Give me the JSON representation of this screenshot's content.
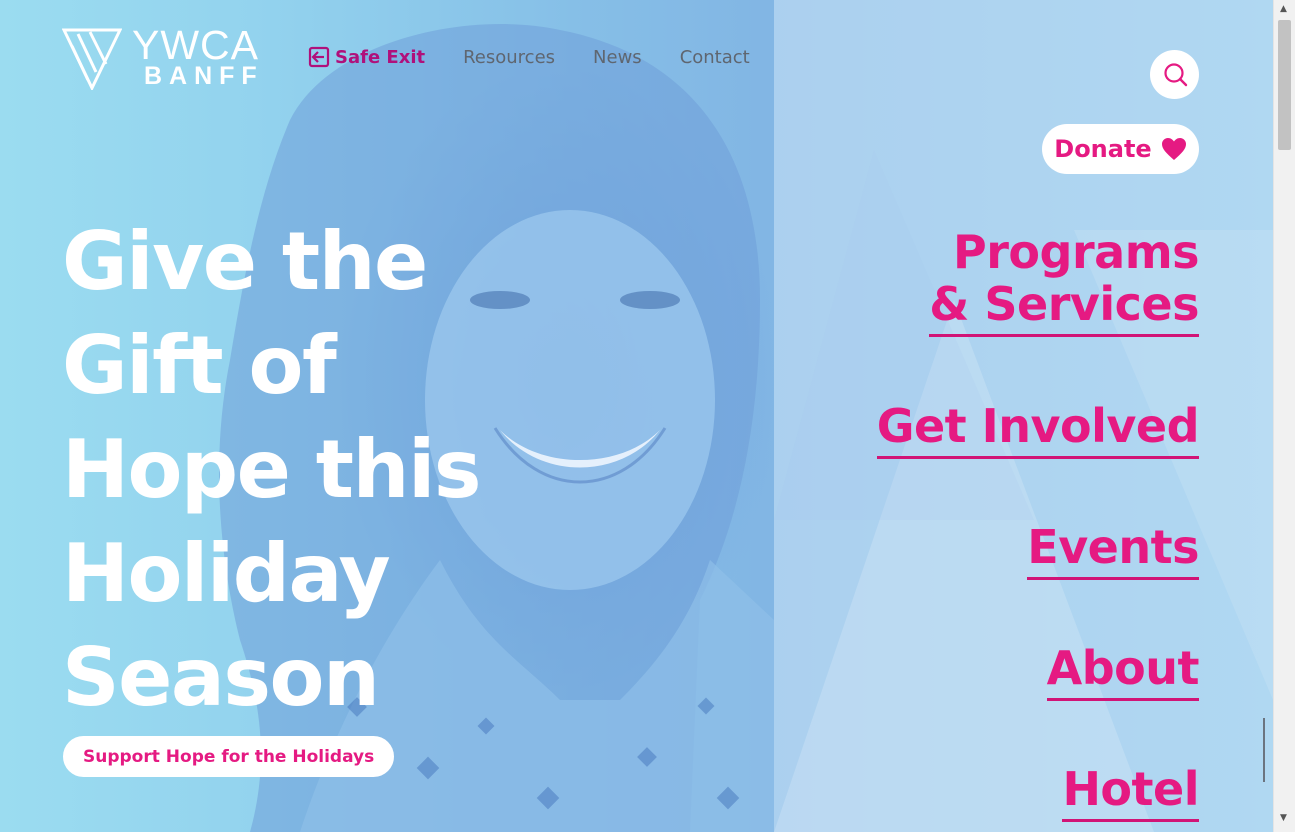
{
  "brand": {
    "line1": "YWCA",
    "line2": "BANFF",
    "accent_color": "#e51a82",
    "exit_color": "#b0107b"
  },
  "topnav": {
    "safe_exit": "Safe Exit",
    "items": [
      "Resources",
      "News",
      "Contact"
    ]
  },
  "actions": {
    "search_icon": "search-icon",
    "donate_label": "Donate",
    "donate_icon": "heart-icon"
  },
  "side_menu": {
    "programs_line1": "Programs",
    "programs_line2": "& Services",
    "get_involved": "Get Involved",
    "events": "Events",
    "about": "About",
    "hotel": "Hotel"
  },
  "hero": {
    "headline": "Give the Gift of Hope this Holiday Season",
    "cta_label": "Support Hope for the Holidays"
  }
}
